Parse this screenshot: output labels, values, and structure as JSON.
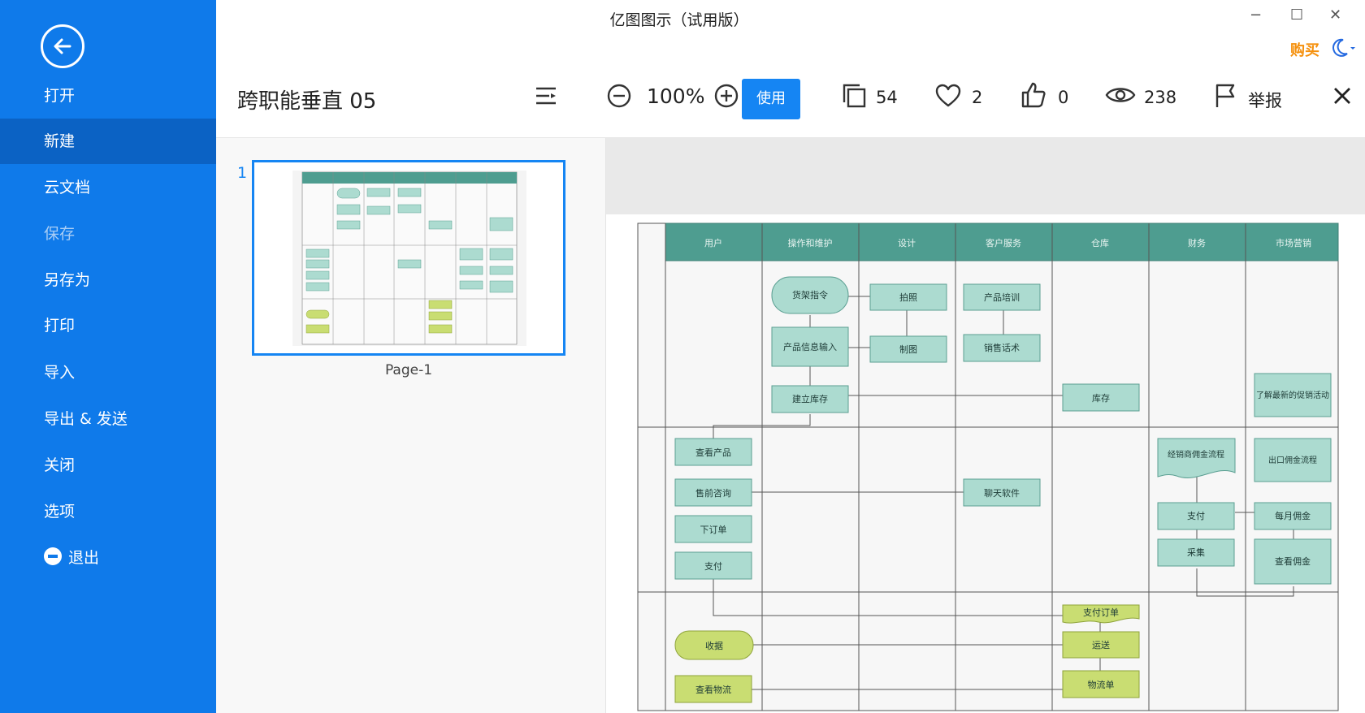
{
  "window": {
    "title": "亿图图示（试用版）",
    "buy_label": "购买",
    "minimize": "−",
    "maximize": "☐",
    "close": "✕"
  },
  "sidebar": {
    "items": [
      {
        "label": "打开",
        "state": "normal"
      },
      {
        "label": "新建",
        "state": "active"
      },
      {
        "label": "云文档",
        "state": "normal"
      },
      {
        "label": "保存",
        "state": "disabled"
      },
      {
        "label": "另存为",
        "state": "normal"
      },
      {
        "label": "打印",
        "state": "normal"
      },
      {
        "label": "导入",
        "state": "normal"
      },
      {
        "label": "导出 & 发送",
        "state": "normal"
      },
      {
        "label": "关闭",
        "state": "normal"
      },
      {
        "label": "选项",
        "state": "normal"
      }
    ],
    "exit_label": "退出",
    "accent": "#0f7aea",
    "active_bg": "#0b62c4"
  },
  "toolbar": {
    "doc_title": "跨职能垂直 05",
    "zoom": "100%",
    "use_label": "使用",
    "copies": "54",
    "likes": "2",
    "thumbs": "0",
    "views": "238",
    "report_label": "举报"
  },
  "pages": {
    "number": "1",
    "label": "Page-1"
  },
  "diagram": {
    "lanes": [
      "用户",
      "操作和维护",
      "设计",
      "客户服务",
      "仓库",
      "财务",
      "市场营销"
    ],
    "nodes": {
      "n1": "货架指令",
      "n2": "拍照",
      "n3": "产品培训",
      "n4": "产品信息输入",
      "n5": "制图",
      "n6": "销售话术",
      "n7": "建立库存",
      "n8": "库存",
      "n9": "了解最新的促销活动",
      "n10": "查看产品",
      "n11": "经销商佣金流程",
      "n12": "出口佣金流程",
      "n13": "售前咨询",
      "n14": "聊天软件",
      "n15": "支付",
      "n16": "每月佣金",
      "n17": "下订单",
      "n18": "采集",
      "n19": "查看佣金",
      "n20": "支付",
      "n21": "支付订单",
      "n22": "收据",
      "n23": "运送",
      "n24": "查看物流",
      "n25": "物流单"
    },
    "colors": {
      "header": "#4e9d90",
      "node_fill": "#acdbd0",
      "node_stroke": "#5b9f92",
      "lime_fill": "#c9dd72",
      "lime_stroke": "#8ea33a"
    }
  }
}
